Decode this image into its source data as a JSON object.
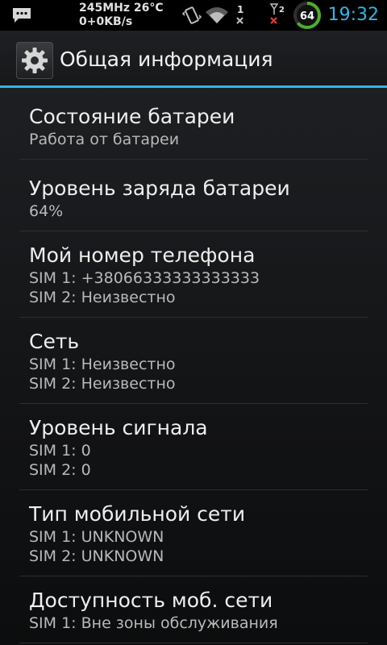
{
  "status_bar": {
    "cpu_temp": "245MHz 26°C",
    "net_speed": "0+0KB/s",
    "battery_level": "64",
    "clock": "19:32",
    "sim1_indicator": "1",
    "sim2_indicator": "2",
    "icons": [
      "message-icon",
      "vibrate-icon",
      "wifi-icon",
      "sim1-no-data-icon",
      "sim2-no-signal-icon",
      "battery-circle-icon"
    ]
  },
  "action_bar": {
    "title": "Общая информация",
    "icon": "settings-gear-icon"
  },
  "preferences": [
    {
      "title": "Состояние батареи",
      "summary": [
        "Работа от батареи"
      ]
    },
    {
      "title": "Уровень заряда батареи",
      "summary": [
        "64%"
      ]
    },
    {
      "title": "Мой номер телефона",
      "summary": [
        "SIM 1: +38066333333333333",
        "SIM 2: Неизвестно"
      ]
    },
    {
      "title": "Сеть",
      "summary": [
        "SIM 1: Неизвестно",
        "SIM 2: Неизвестно"
      ]
    },
    {
      "title": "Уровень сигнала",
      "summary": [
        "SIM 1: 0",
        "SIM 2: 0"
      ]
    },
    {
      "title": "Тип мобильной сети",
      "summary": [
        "SIM 1: UNKNOWN",
        "SIM 2: UNKNOWN"
      ]
    },
    {
      "title": "Доступность моб. сети",
      "summary": [
        "SIM 1: Вне зоны обслуживания"
      ]
    }
  ],
  "colors": {
    "accent": "#33b5e5",
    "battery_ring": "#4caf2a",
    "error_x": "#e53935"
  }
}
